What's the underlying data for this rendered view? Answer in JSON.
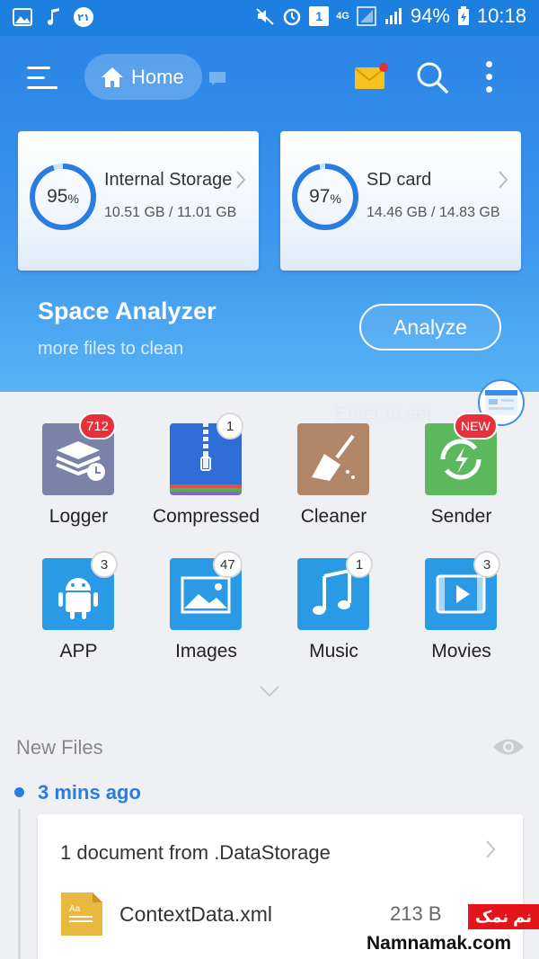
{
  "status_bar": {
    "left_badge": "۲۱",
    "battery": "94%",
    "time": "10:18",
    "net": "4G",
    "sim_slot": "1"
  },
  "app_bar": {
    "home_label": "Home"
  },
  "storage": [
    {
      "name": "Internal Storage",
      "percent": "95",
      "percent_value": 95,
      "size": "10.51 GB / 11.01 GB"
    },
    {
      "name": "SD card",
      "percent": "97",
      "percent_value": 97,
      "size": "14.46 GB / 14.83 GB"
    }
  ],
  "space_analyzer": {
    "title": "Space Analyzer",
    "subtitle": "more files to clean",
    "button": "Analyze"
  },
  "floating": {
    "hint": "Enter to set"
  },
  "categories": [
    {
      "label": "Logger",
      "badge": "712",
      "color": "#7b82a8"
    },
    {
      "label": "Compressed",
      "badge": "1",
      "color": "#2f6ed8"
    },
    {
      "label": "Cleaner",
      "badge": "",
      "color": "#b08568"
    },
    {
      "label": "Sender",
      "badge": "NEW",
      "color": "#5cb85c"
    },
    {
      "label": "APP",
      "badge": "3",
      "color": "#2a9ae6"
    },
    {
      "label": "Images",
      "badge": "47",
      "color": "#2a9ae6"
    },
    {
      "label": "Music",
      "badge": "1",
      "color": "#2a9ae6"
    },
    {
      "label": "Movies",
      "badge": "3",
      "color": "#2a9ae6"
    }
  ],
  "new_files": {
    "title": "New Files",
    "time": "3 mins ago",
    "group_title": "1 document from .DataStorage",
    "file_name": "ContextData.xml",
    "file_size": "213 B",
    "file_icon_text": "Aa"
  },
  "watermark": {
    "badge": "نم نمک",
    "site": "Namnamak.com"
  }
}
